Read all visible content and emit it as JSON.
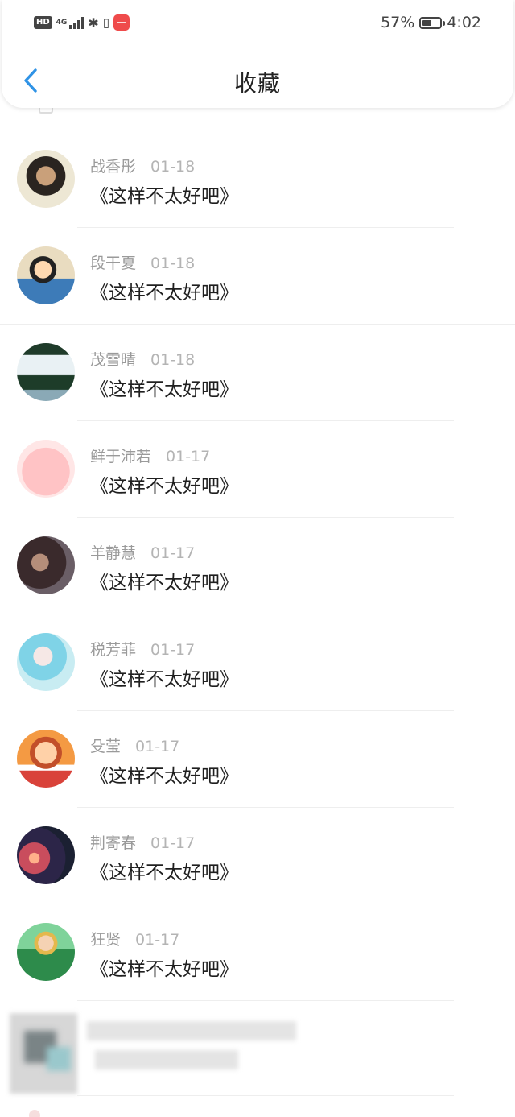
{
  "status_bar": {
    "hd_label": "HD",
    "network": "4G",
    "battery": "57%",
    "battery_level": 0.57,
    "time": "4:02"
  },
  "header": {
    "title": "收藏",
    "back_icon": "chevron-left-icon"
  },
  "colors": {
    "accent": "#2f93e6",
    "name": "#9a9a9a",
    "content": "#1f1f1f"
  },
  "items": [
    {
      "name": "战香彤",
      "date": "01-18",
      "content": "《这样不太好吧》",
      "avatar": "person-photo"
    },
    {
      "name": "段干夏",
      "date": "01-18",
      "content": "《这样不太好吧》",
      "avatar": "cartoon"
    },
    {
      "name": "茂雪晴",
      "date": "01-18",
      "content": "《这样不太好吧》",
      "avatar": "waterfall"
    },
    {
      "name": "鲜于沛若",
      "date": "01-17",
      "content": "《这样不太好吧》",
      "avatar": "pink-character"
    },
    {
      "name": "羊静慧",
      "date": "01-17",
      "content": "《这样不太好吧》",
      "avatar": "person-photo-dark"
    },
    {
      "name": "税芳菲",
      "date": "01-17",
      "content": "《这样不太好吧》",
      "avatar": "anime-girl"
    },
    {
      "name": "殳莹",
      "date": "01-17",
      "content": "《这样不太好吧》",
      "avatar": "cartoon-glasses"
    },
    {
      "name": "荆寄春",
      "date": "01-17",
      "content": "《这样不太好吧》",
      "avatar": "sunset"
    },
    {
      "name": "狂贤",
      "date": "01-17",
      "content": "《这样不太好吧》",
      "avatar": "green-character"
    }
  ]
}
